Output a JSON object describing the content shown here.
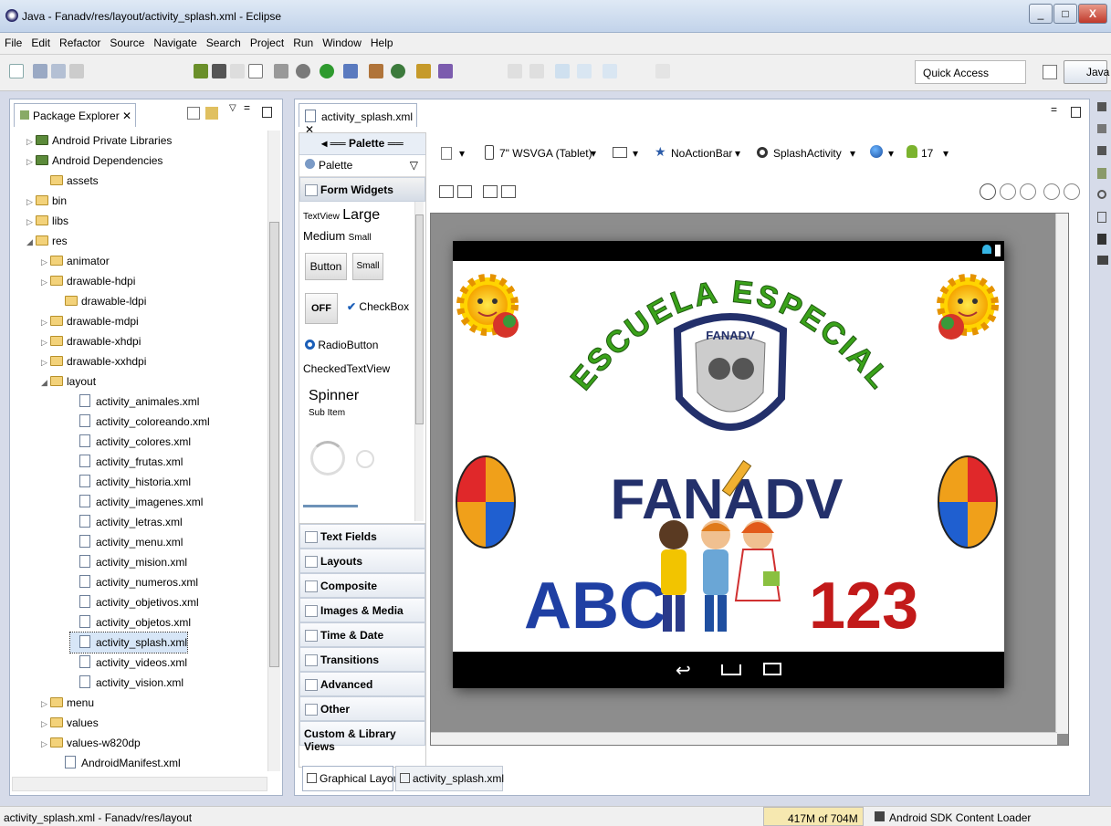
{
  "window": {
    "title": "Java - Fanadv/res/layout/activity_splash.xml - Eclipse"
  },
  "menu": [
    "File",
    "Edit",
    "Refactor",
    "Source",
    "Navigate",
    "Search",
    "Project",
    "Run",
    "Window",
    "Help"
  ],
  "toolbar": {
    "quick_access": "Quick Access",
    "perspective": "Java"
  },
  "package_explorer": {
    "tab": "Package Explorer",
    "items": [
      {
        "label": "Android Private Libraries",
        "type": "lib"
      },
      {
        "label": "Android Dependencies",
        "type": "lib"
      },
      {
        "label": "assets",
        "type": "folder"
      },
      {
        "label": "bin",
        "type": "folder"
      },
      {
        "label": "libs",
        "type": "folder"
      },
      {
        "label": "res",
        "type": "folder"
      },
      {
        "label": "animator",
        "type": "folder"
      },
      {
        "label": "drawable-hdpi",
        "type": "folder"
      },
      {
        "label": "drawable-ldpi",
        "type": "folder"
      },
      {
        "label": "drawable-mdpi",
        "type": "folder"
      },
      {
        "label": "drawable-xhdpi",
        "type": "folder"
      },
      {
        "label": "drawable-xxhdpi",
        "type": "folder"
      },
      {
        "label": "layout",
        "type": "folder"
      },
      {
        "label": "activity_animales.xml",
        "type": "file"
      },
      {
        "label": "activity_coloreando.xml",
        "type": "file"
      },
      {
        "label": "activity_colores.xml",
        "type": "file"
      },
      {
        "label": "activity_frutas.xml",
        "type": "file"
      },
      {
        "label": "activity_historia.xml",
        "type": "file"
      },
      {
        "label": "activity_imagenes.xml",
        "type": "file"
      },
      {
        "label": "activity_letras.xml",
        "type": "file"
      },
      {
        "label": "activity_menu.xml",
        "type": "file"
      },
      {
        "label": "activity_mision.xml",
        "type": "file"
      },
      {
        "label": "activity_numeros.xml",
        "type": "file"
      },
      {
        "label": "activity_objetivos.xml",
        "type": "file"
      },
      {
        "label": "activity_objetos.xml",
        "type": "file"
      },
      {
        "label": "activity_splash.xml",
        "type": "file"
      },
      {
        "label": "activity_videos.xml",
        "type": "file"
      },
      {
        "label": "activity_vision.xml",
        "type": "file"
      },
      {
        "label": "menu",
        "type": "folder"
      },
      {
        "label": "values",
        "type": "folder"
      },
      {
        "label": "values-w820dp",
        "type": "folder"
      },
      {
        "label": "AndroidManifest.xml",
        "type": "file"
      }
    ]
  },
  "editor": {
    "tab": "activity_splash.xml",
    "palette_title": "Palette",
    "palette_dropdown": "Palette",
    "form_widgets": "Form Widgets",
    "widgets": {
      "textview": "TextView",
      "large": "Large",
      "medium": "Medium",
      "small": "Small",
      "button": "Button",
      "small_button": "Small",
      "off": "OFF",
      "checkbox": "CheckBox",
      "radio": "RadioButton",
      "checked_text": "CheckedTextView",
      "spinner": "Spinner",
      "sub_item": "Sub Item"
    },
    "categories": [
      "Text Fields",
      "Layouts",
      "Composite",
      "Images & Media",
      "Time & Date",
      "Transitions",
      "Advanced",
      "Other",
      "Custom & Library Views"
    ],
    "device": "7\" WSVGA (Tablet)",
    "theme": "NoActionBar",
    "activity": "SplashActivity",
    "api": "17",
    "bottom_tabs": [
      "Graphical Layout",
      "activity_splash.xml"
    ]
  },
  "splash": {
    "arc_text": "ESCUELA ESPECIAL",
    "badge": "FANADV",
    "brand": "FANADV",
    "letters": "ABC",
    "numbers": "123",
    "colors": {
      "green": "#3aa21a",
      "navy": "#23306b",
      "blue": "#1f3fa3",
      "red": "#c21a1a"
    }
  },
  "status": {
    "path": "activity_splash.xml - Fanadv/res/layout",
    "memory": "417M of 704M",
    "loader": "Android SDK Content Loader"
  }
}
